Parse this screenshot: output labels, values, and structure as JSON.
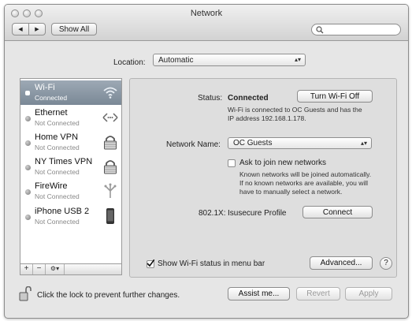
{
  "window": {
    "title": "Network"
  },
  "toolbar": {
    "back_label": "◀",
    "forward_label": "▶",
    "show_all_label": "Show All",
    "search_placeholder": ""
  },
  "location": {
    "label": "Location:",
    "value": "Automatic"
  },
  "services": [
    {
      "name": "Wi-Fi",
      "status": "Connected",
      "icon": "wifi-icon",
      "selected": true
    },
    {
      "name": "Ethernet",
      "status": "Not Connected",
      "icon": "ethernet-icon"
    },
    {
      "name": "Home VPN",
      "status": "Not Connected",
      "icon": "vpn-lock-icon"
    },
    {
      "name": "NY Times VPN",
      "status": "Not Connected",
      "icon": "vpn-lock-icon"
    },
    {
      "name": "FireWire",
      "status": "Not Connected",
      "icon": "firewire-icon"
    },
    {
      "name": "iPhone USB 2",
      "status": "Not Connected",
      "icon": "iphone-icon"
    }
  ],
  "list_bar": {
    "add": "+",
    "remove": "−",
    "action": "⚙▾"
  },
  "detail": {
    "status_label": "Status:",
    "status_value": "Connected",
    "toggle_button": "Turn Wi-Fi Off",
    "status_desc_1": "Wi-Fi is connected to OC Guests and has the",
    "status_desc_2": "IP address 192.168.1.178.",
    "network_name_label": "Network Name:",
    "network_name_value": "OC Guests",
    "ask_join_label": "Ask to join new networks",
    "ask_desc_1": "Known networks will be joined automatically.",
    "ask_desc_2": "If no known networks are available, you will",
    "ask_desc_3": "have to manually select a network.",
    "dot1x_label": "802.1X:",
    "dot1x_value": "Isusecure Profile",
    "connect_button": "Connect",
    "show_status_label": "Show Wi-Fi status in menu bar",
    "advanced_button": "Advanced...",
    "help": "?"
  },
  "footer": {
    "lock_text": "Click the lock to prevent further changes.",
    "assist_button": "Assist me...",
    "revert_button": "Revert",
    "apply_button": "Apply"
  }
}
